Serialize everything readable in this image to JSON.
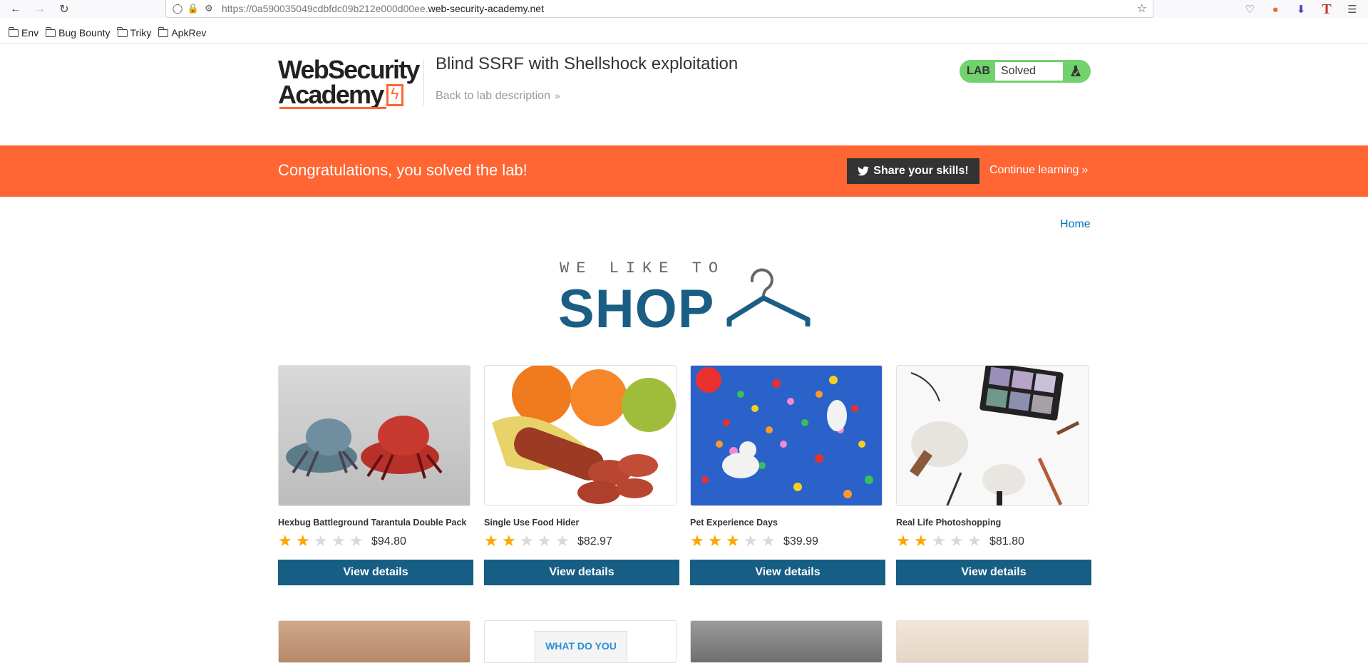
{
  "browser": {
    "url_prefix": "https://0a590035049cdbfdc09b212e000d00ee.",
    "url_domain": "web-security-academy.net",
    "bookmarks": [
      "Env",
      "Bug Bounty",
      "Triky",
      "ApkRev"
    ]
  },
  "header": {
    "logo_line1": "WebSecurity",
    "logo_line2": "Academy",
    "lab_title": "Blind SSRF with Shellshock exploitation",
    "back_link": "Back to lab description",
    "badge_label": "LAB",
    "badge_status": "Solved"
  },
  "banner": {
    "message": "Congratulations, you solved the lab!",
    "share_label": "Share your skills!",
    "continue_label": "Continue learning"
  },
  "nav": {
    "home": "Home"
  },
  "shop_logo": {
    "tagline": "WE LIKE TO",
    "word": "SHOP"
  },
  "colors": {
    "accent": "#ff6633",
    "primary_button": "#165e84",
    "lab_green": "#70d16d",
    "star": "#ffa500"
  },
  "products": [
    {
      "name": "Hexbug Battleground Tarantula Double Pack",
      "rating": 2,
      "price": "$94.80",
      "button": "View details"
    },
    {
      "name": "Single Use Food Hider",
      "rating": 2,
      "price": "$82.97",
      "button": "View details"
    },
    {
      "name": "Pet Experience Days",
      "rating": 3,
      "price": "$39.99",
      "button": "View details"
    },
    {
      "name": "Real Life Photoshopping",
      "rating": 2,
      "price": "$81.80",
      "button": "View details"
    }
  ],
  "second_row_partial_text": "WHAT DO YOU"
}
